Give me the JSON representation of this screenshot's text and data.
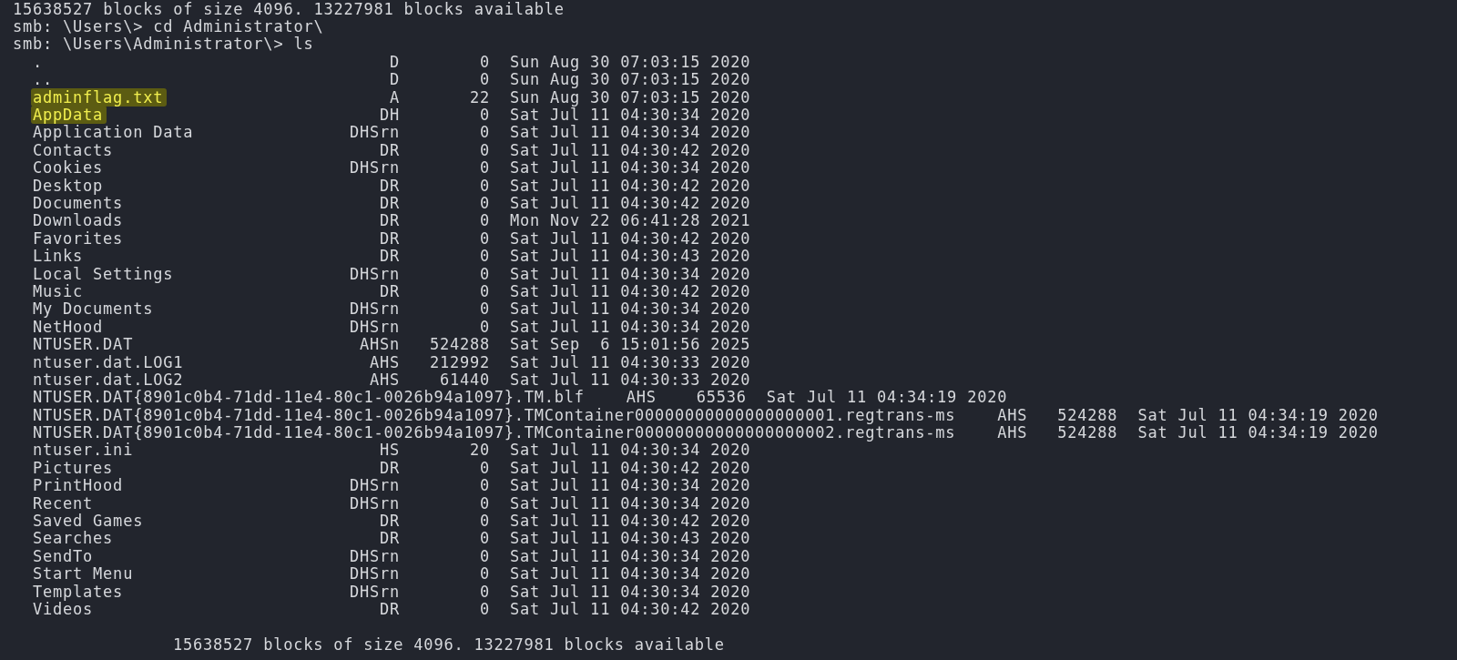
{
  "terminal": {
    "output_top": "15638527 blocks of size 4096. 13227981 blocks available",
    "commands": [
      {
        "prompt": "smb: \\Users\\>",
        "command": "cd Administrator\\"
      },
      {
        "prompt": "smb: \\Users\\Administrator\\>",
        "command": "ls"
      }
    ],
    "entries": [
      {
        "name": ".",
        "attributes": "D",
        "size": "0",
        "modified": "Sun Aug 30 07:03:15 2020",
        "highlighted": false
      },
      {
        "name": "..",
        "attributes": "D",
        "size": "0",
        "modified": "Sun Aug 30 07:03:15 2020",
        "highlighted": false
      },
      {
        "name": "adminflag.txt",
        "attributes": "A",
        "size": "22",
        "modified": "Sun Aug 30 07:03:15 2020",
        "highlighted": true
      },
      {
        "name": "AppData",
        "attributes": "DH",
        "size": "0",
        "modified": "Sat Jul 11 04:30:34 2020",
        "highlighted": true
      },
      {
        "name": "Application Data",
        "attributes": "DHSrn",
        "size": "0",
        "modified": "Sat Jul 11 04:30:34 2020",
        "highlighted": false
      },
      {
        "name": "Contacts",
        "attributes": "DR",
        "size": "0",
        "modified": "Sat Jul 11 04:30:42 2020",
        "highlighted": false
      },
      {
        "name": "Cookies",
        "attributes": "DHSrn",
        "size": "0",
        "modified": "Sat Jul 11 04:30:34 2020",
        "highlighted": false
      },
      {
        "name": "Desktop",
        "attributes": "DR",
        "size": "0",
        "modified": "Sat Jul 11 04:30:42 2020",
        "highlighted": false
      },
      {
        "name": "Documents",
        "attributes": "DR",
        "size": "0",
        "modified": "Sat Jul 11 04:30:42 2020",
        "highlighted": false
      },
      {
        "name": "Downloads",
        "attributes": "DR",
        "size": "0",
        "modified": "Mon Nov 22 06:41:28 2021",
        "highlighted": false
      },
      {
        "name": "Favorites",
        "attributes": "DR",
        "size": "0",
        "modified": "Sat Jul 11 04:30:42 2020",
        "highlighted": false
      },
      {
        "name": "Links",
        "attributes": "DR",
        "size": "0",
        "modified": "Sat Jul 11 04:30:43 2020",
        "highlighted": false
      },
      {
        "name": "Local Settings",
        "attributes": "DHSrn",
        "size": "0",
        "modified": "Sat Jul 11 04:30:34 2020",
        "highlighted": false
      },
      {
        "name": "Music",
        "attributes": "DR",
        "size": "0",
        "modified": "Sat Jul 11 04:30:42 2020",
        "highlighted": false
      },
      {
        "name": "My Documents",
        "attributes": "DHSrn",
        "size": "0",
        "modified": "Sat Jul 11 04:30:34 2020",
        "highlighted": false
      },
      {
        "name": "NetHood",
        "attributes": "DHSrn",
        "size": "0",
        "modified": "Sat Jul 11 04:30:34 2020",
        "highlighted": false
      },
      {
        "name": "NTUSER.DAT",
        "attributes": "AHSn",
        "size": "524288",
        "modified": "Sat Sep  6 15:01:56 2025",
        "highlighted": false
      },
      {
        "name": "ntuser.dat.LOG1",
        "attributes": "AHS",
        "size": "212992",
        "modified": "Sat Jul 11 04:30:33 2020",
        "highlighted": false
      },
      {
        "name": "ntuser.dat.LOG2",
        "attributes": "AHS",
        "size": "61440",
        "modified": "Sat Jul 11 04:30:33 2020",
        "highlighted": false
      },
      {
        "name": "NTUSER.DAT{8901c0b4-71dd-11e4-80c1-0026b94a1097}.TM.blf",
        "attributes": "AHS",
        "size": "65536",
        "modified": "Sat Jul 11 04:34:19 2020",
        "highlighted": false
      },
      {
        "name": "NTUSER.DAT{8901c0b4-71dd-11e4-80c1-0026b94a1097}.TMContainer00000000000000000001.regtrans-ms",
        "attributes": "AHS",
        "size": "524288",
        "modified": "Sat Jul 11 04:34:19 2020",
        "highlighted": false
      },
      {
        "name": "NTUSER.DAT{8901c0b4-71dd-11e4-80c1-0026b94a1097}.TMContainer00000000000000000002.regtrans-ms",
        "attributes": "AHS",
        "size": "524288",
        "modified": "Sat Jul 11 04:34:19 2020",
        "highlighted": false
      },
      {
        "name": "ntuser.ini",
        "attributes": "HS",
        "size": "20",
        "modified": "Sat Jul 11 04:30:34 2020",
        "highlighted": false
      },
      {
        "name": "Pictures",
        "attributes": "DR",
        "size": "0",
        "modified": "Sat Jul 11 04:30:42 2020",
        "highlighted": false
      },
      {
        "name": "PrintHood",
        "attributes": "DHSrn",
        "size": "0",
        "modified": "Sat Jul 11 04:30:34 2020",
        "highlighted": false
      },
      {
        "name": "Recent",
        "attributes": "DHSrn",
        "size": "0",
        "modified": "Sat Jul 11 04:30:34 2020",
        "highlighted": false
      },
      {
        "name": "Saved Games",
        "attributes": "DR",
        "size": "0",
        "modified": "Sat Jul 11 04:30:42 2020",
        "highlighted": false
      },
      {
        "name": "Searches",
        "attributes": "DR",
        "size": "0",
        "modified": "Sat Jul 11 04:30:43 2020",
        "highlighted": false
      },
      {
        "name": "SendTo",
        "attributes": "DHSrn",
        "size": "0",
        "modified": "Sat Jul 11 04:30:34 2020",
        "highlighted": false
      },
      {
        "name": "Start Menu",
        "attributes": "DHSrn",
        "size": "0",
        "modified": "Sat Jul 11 04:30:34 2020",
        "highlighted": false
      },
      {
        "name": "Templates",
        "attributes": "DHSrn",
        "size": "0",
        "modified": "Sat Jul 11 04:30:34 2020",
        "highlighted": false
      },
      {
        "name": "Videos",
        "attributes": "DR",
        "size": "0",
        "modified": "Sat Jul 11 04:30:42 2020",
        "highlighted": false
      }
    ],
    "summary": "15638527 blocks of size 4096. 13227981 blocks available"
  }
}
